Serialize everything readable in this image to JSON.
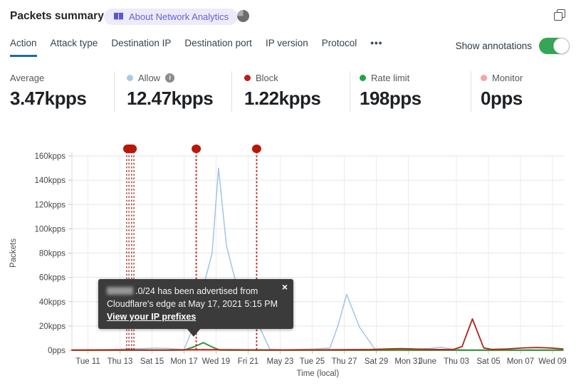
{
  "header": {
    "title": "Packets summary",
    "badge_label": "About Network Analytics"
  },
  "tabs": {
    "items": [
      "Action",
      "Attack type",
      "Destination IP",
      "Destination port",
      "IP version",
      "Protocol"
    ],
    "active": "Action",
    "more_icon": "•••"
  },
  "toolbar": {
    "show_annotations_label": "Show annotations",
    "annotations_on": true,
    "toggle_color": "#35a556"
  },
  "stats": [
    {
      "label": "Average",
      "value": "3.47kpps",
      "dot_color": null,
      "has_info": false
    },
    {
      "label": "Allow",
      "value": "12.47kpps",
      "dot_color": "#a9c9ea",
      "has_info": true
    },
    {
      "label": "Block",
      "value": "1.22kpps",
      "dot_color": "#b6201e",
      "has_info": false
    },
    {
      "label": "Rate limit",
      "value": "198pps",
      "dot_color": "#1fa63f",
      "has_info": false
    },
    {
      "label": "Monitor",
      "value": "0pps",
      "dot_color": "#f7a3a3",
      "has_info": false
    }
  ],
  "tooltip": {
    "line1_after_redaction": ".0/24 has been advertised from",
    "line2": "Cloudflare's edge at May 17, 2021 5:15 PM",
    "link": "View your IP prefixes",
    "close_icon": "×"
  },
  "chart_data": {
    "type": "line",
    "ylabel": "Packets",
    "xlabel": "Time (local)",
    "ylim": [
      0,
      160
    ],
    "xlim_days": [
      0,
      30.7
    ],
    "grid": true,
    "y_ticks": [
      {
        "value": 0,
        "label": "0pps"
      },
      {
        "value": 20,
        "label": "20kpps"
      },
      {
        "value": 40,
        "label": "40kpps"
      },
      {
        "value": 60,
        "label": "60kpps"
      },
      {
        "value": 80,
        "label": "80kpps"
      },
      {
        "value": 100,
        "label": "100kpps"
      },
      {
        "value": 120,
        "label": "120kpps"
      },
      {
        "value": 140,
        "label": "140kpps"
      },
      {
        "value": 160,
        "label": "160kpps"
      }
    ],
    "x_ticks": [
      {
        "day": 1,
        "label": "Tue 11"
      },
      {
        "day": 3,
        "label": "Thu 13"
      },
      {
        "day": 5,
        "label": "Sat 15"
      },
      {
        "day": 7,
        "label": "Mon 17"
      },
      {
        "day": 9,
        "label": "Wed 19"
      },
      {
        "day": 11,
        "label": "Fri 21"
      },
      {
        "day": 13,
        "label": "May 23"
      },
      {
        "day": 15,
        "label": "Tue 25"
      },
      {
        "day": 17,
        "label": "Thu 27"
      },
      {
        "day": 19,
        "label": "Sat 29"
      },
      {
        "day": 21,
        "label": "Mon 31"
      },
      {
        "day": 22.2,
        "label": "June",
        "no_grid": true
      },
      {
        "day": 24,
        "label": "Thu 03"
      },
      {
        "day": 26,
        "label": "Sat 05"
      },
      {
        "day": 28,
        "label": "Mon 07"
      },
      {
        "day": 30,
        "label": "Wed 09"
      }
    ],
    "series": [
      {
        "name": "Allow",
        "color": "#a3c4e8",
        "width": 1.5,
        "points": [
          [
            0,
            0.2
          ],
          [
            1,
            0.35
          ],
          [
            2,
            0.55
          ],
          [
            3,
            0.9
          ],
          [
            3.6,
            1.3
          ],
          [
            4.4,
            1.4
          ],
          [
            5.2,
            1.8
          ],
          [
            6,
            1.5
          ],
          [
            6.6,
            0.9
          ],
          [
            7.0,
            0.5
          ],
          [
            7.5,
            17
          ],
          [
            8.2,
            52
          ],
          [
            8.75,
            80
          ],
          [
            9.15,
            150
          ],
          [
            9.65,
            86
          ],
          [
            10.15,
            60
          ],
          [
            11.0,
            34
          ],
          [
            11.75,
            18
          ],
          [
            12.35,
            0.9
          ],
          [
            13.2,
            0.5
          ],
          [
            14.2,
            0.7
          ],
          [
            15.2,
            1.1
          ],
          [
            16.1,
            1.8
          ],
          [
            16.6,
            20
          ],
          [
            17.15,
            46
          ],
          [
            17.95,
            19
          ],
          [
            18.9,
            1.2
          ],
          [
            19.6,
            0.5
          ],
          [
            20.6,
            0.4
          ],
          [
            21.6,
            0.7
          ],
          [
            22.4,
            1.6
          ],
          [
            23.0,
            2.6
          ],
          [
            23.7,
            1.1
          ],
          [
            24.6,
            0.5
          ],
          [
            25.6,
            0.4
          ],
          [
            26.6,
            0.5
          ],
          [
            27.6,
            0.4
          ],
          [
            28.6,
            0.5
          ],
          [
            29.6,
            0.4
          ],
          [
            30.65,
            0.4
          ]
        ]
      },
      {
        "name": "Monitor",
        "color": "#f6a2a0",
        "width": 2.2,
        "points": [
          [
            0,
            0.02
          ],
          [
            30.65,
            0.02
          ]
        ]
      },
      {
        "name": "Rate limit",
        "color": "#2f9a3c",
        "width": 2,
        "points": [
          [
            0,
            0.05
          ],
          [
            6.4,
            0.08
          ],
          [
            7.05,
            0.3
          ],
          [
            7.7,
            3.2
          ],
          [
            8.2,
            6.3
          ],
          [
            8.7,
            3.0
          ],
          [
            9.2,
            0.3
          ],
          [
            9.8,
            0.08
          ],
          [
            30.65,
            0.05
          ]
        ]
      },
      {
        "name": "Block",
        "color": "#b02519",
        "width": 1.8,
        "points": [
          [
            0,
            0.25
          ],
          [
            3,
            0.3
          ],
          [
            6,
            0.3
          ],
          [
            7.5,
            0.55
          ],
          [
            9,
            0.5
          ],
          [
            11,
            0.35
          ],
          [
            13,
            0.3
          ],
          [
            15,
            0.35
          ],
          [
            17,
            0.45
          ],
          [
            18.5,
            0.6
          ],
          [
            19.5,
            1.0
          ],
          [
            20.5,
            1.35
          ],
          [
            21.5,
            1.0
          ],
          [
            22.5,
            0.7
          ],
          [
            23.8,
            0.6
          ],
          [
            24.35,
            3
          ],
          [
            25.0,
            25.8
          ],
          [
            25.7,
            2
          ],
          [
            26.2,
            0.7
          ],
          [
            27.2,
            1.1
          ],
          [
            28.2,
            2.0
          ],
          [
            29.0,
            2.3
          ],
          [
            29.9,
            1.9
          ],
          [
            30.65,
            1.1
          ]
        ]
      }
    ],
    "annotations": {
      "marker_color": "#b8170c",
      "lines": [
        {
          "day": 3.42,
          "color": "#9e1508",
          "width": 1.2
        },
        {
          "day": 3.56,
          "color": "#9e1508",
          "width": 1.2
        },
        {
          "day": 3.73,
          "color": "#9e1508",
          "width": 1.2
        },
        {
          "day": 3.87,
          "color": "#9e1508",
          "width": 1.2
        },
        {
          "day": 7.76,
          "color": "#cf2317",
          "width": 2.0
        },
        {
          "day": 11.53,
          "color": "#b81b10",
          "width": 1.8
        }
      ],
      "markers": [
        {
          "shape": "pill",
          "day_from": 3.2,
          "day_to": 4.05
        },
        {
          "shape": "dot",
          "day": 7.76
        },
        {
          "shape": "dot",
          "day": 11.53
        }
      ]
    }
  }
}
